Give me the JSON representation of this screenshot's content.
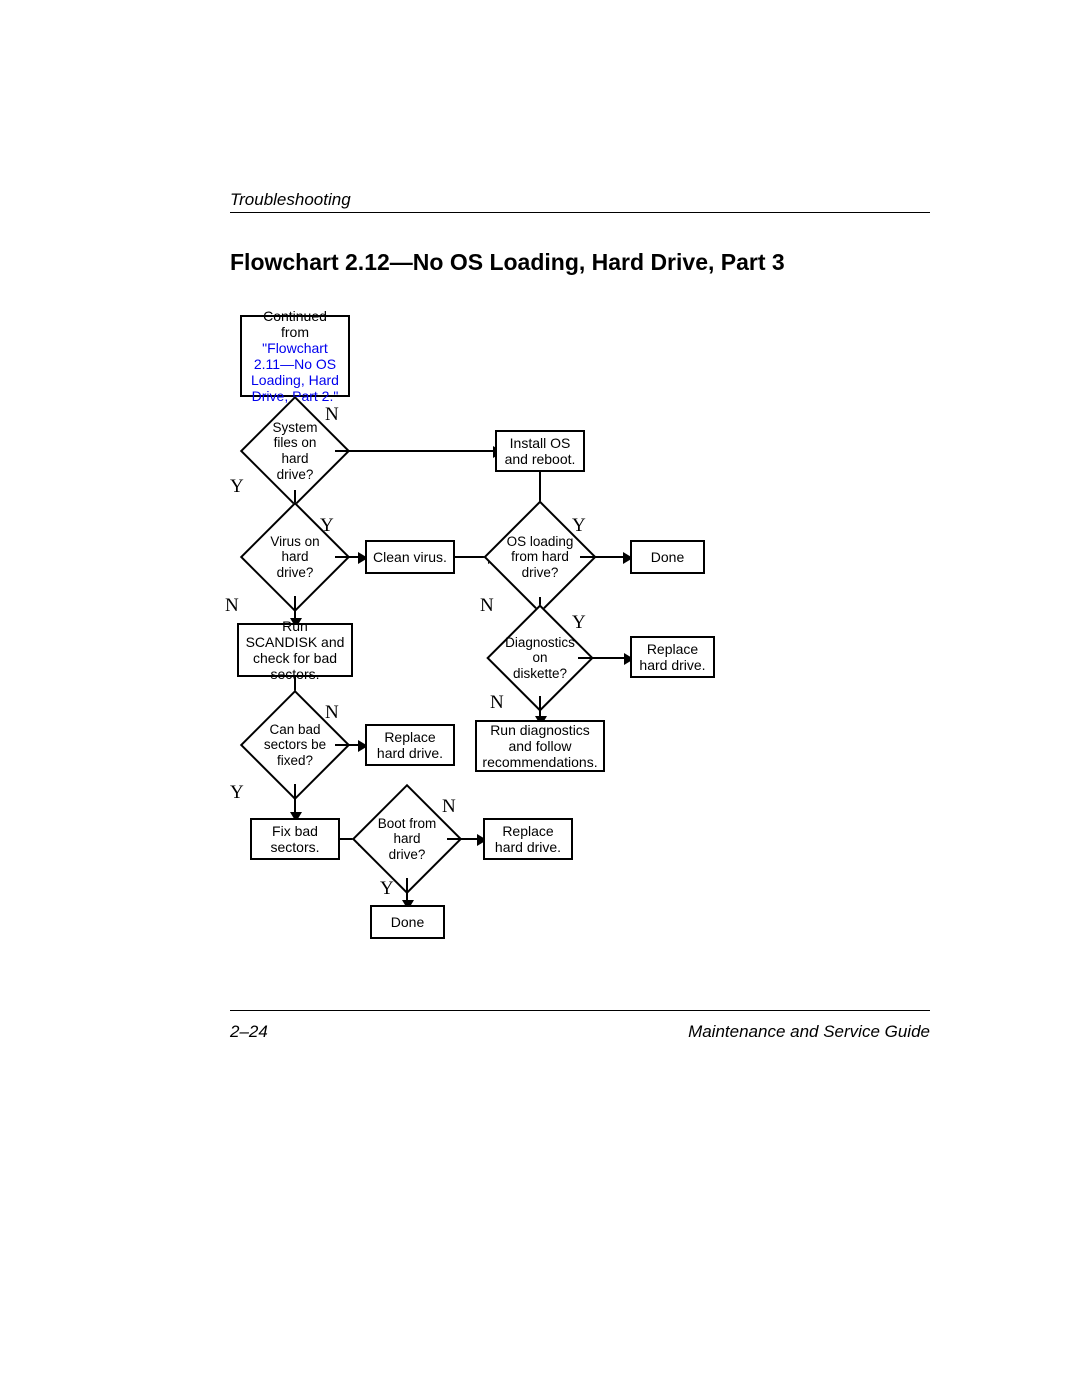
{
  "header": {
    "section": "Troubleshooting"
  },
  "title": "Flowchart 2.12—No OS Loading, Hard Drive, Part 3",
  "footer": {
    "page": "2–24",
    "guide": "Maintenance and Service Guide"
  },
  "labels": {
    "Y": "Y",
    "N": "N"
  },
  "chart_data": {
    "type": "flowchart",
    "nodes": [
      {
        "id": "start",
        "kind": "process",
        "text_a": "Continued from",
        "text_link": "\"Flowchart 2.11—No OS Loading, Hard Drive, Part 2.\""
      },
      {
        "id": "sysfiles",
        "kind": "decision",
        "text": "System files on hard drive?"
      },
      {
        "id": "install",
        "kind": "process",
        "text": "Install OS and reboot."
      },
      {
        "id": "virus",
        "kind": "decision",
        "text": "Virus on hard drive?"
      },
      {
        "id": "clean",
        "kind": "process",
        "text": "Clean virus."
      },
      {
        "id": "osload",
        "kind": "decision",
        "text": "OS loading from hard drive?"
      },
      {
        "id": "done1",
        "kind": "process",
        "text": "Done"
      },
      {
        "id": "scandisk",
        "kind": "process",
        "text": "Run SCANDISK and check for bad sectors."
      },
      {
        "id": "diag",
        "kind": "decision",
        "text": "Diagnostics on diskette?"
      },
      {
        "id": "replace1",
        "kind": "process",
        "text": "Replace hard drive."
      },
      {
        "id": "canfix",
        "kind": "decision",
        "text": "Can bad sectors be fixed?"
      },
      {
        "id": "replace2",
        "kind": "process",
        "text": "Replace hard drive."
      },
      {
        "id": "rundiag",
        "kind": "process",
        "text": "Run diagnostics and follow recommendations."
      },
      {
        "id": "fixbad",
        "kind": "process",
        "text": "Fix bad sectors."
      },
      {
        "id": "bootfrom",
        "kind": "decision",
        "text": "Boot from hard drive?"
      },
      {
        "id": "replace3",
        "kind": "process",
        "text": "Replace hard drive."
      },
      {
        "id": "done2",
        "kind": "process",
        "text": "Done"
      }
    ],
    "edges": [
      {
        "from": "start",
        "to": "sysfiles"
      },
      {
        "from": "sysfiles",
        "to": "install",
        "label": "N"
      },
      {
        "from": "sysfiles",
        "to": "virus",
        "label": "Y"
      },
      {
        "from": "install",
        "to": "osload"
      },
      {
        "from": "virus",
        "to": "clean",
        "label": "Y"
      },
      {
        "from": "virus",
        "to": "scandisk",
        "label": "N"
      },
      {
        "from": "clean",
        "to": "osload"
      },
      {
        "from": "osload",
        "to": "done1",
        "label": "Y"
      },
      {
        "from": "osload",
        "to": "diag",
        "label": "N"
      },
      {
        "from": "diag",
        "to": "replace1",
        "label": "Y"
      },
      {
        "from": "diag",
        "to": "rundiag",
        "label": "N"
      },
      {
        "from": "scandisk",
        "to": "canfix"
      },
      {
        "from": "canfix",
        "to": "replace2",
        "label": "N"
      },
      {
        "from": "canfix",
        "to": "fixbad",
        "label": "Y"
      },
      {
        "from": "fixbad",
        "to": "bootfrom"
      },
      {
        "from": "bootfrom",
        "to": "replace3",
        "label": "N"
      },
      {
        "from": "bootfrom",
        "to": "done2",
        "label": "Y"
      }
    ]
  }
}
